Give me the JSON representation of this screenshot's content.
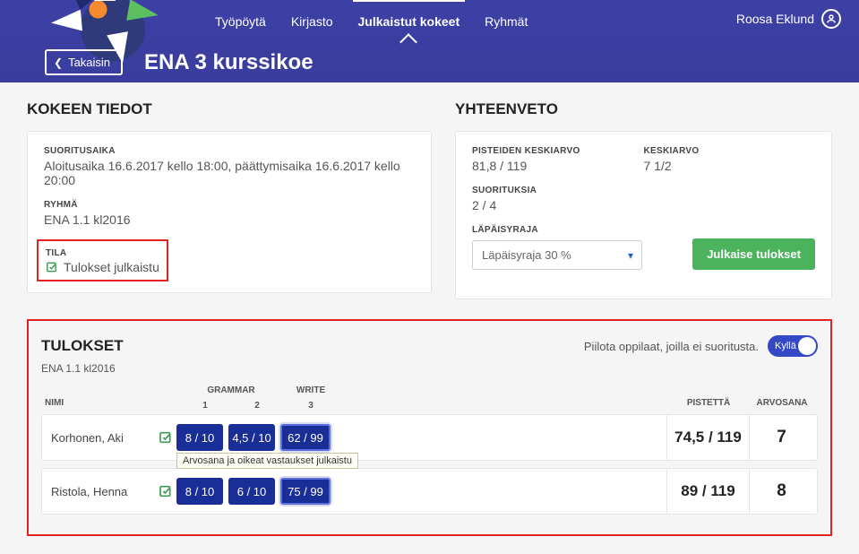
{
  "header": {
    "nav": {
      "tyopoyto": "Työpöytä",
      "kirjasto": "Kirjasto",
      "julkaistut": "Julkaistut kokeet",
      "ryhmat": "Ryhmät"
    },
    "user_name": "Roosa Eklund",
    "back_label": "Takaisin",
    "page_title": "ENA 3 kurssikoe"
  },
  "kokeen_tiedot": {
    "section_title": "KOKEEN TIEDOT",
    "suori_label": "SUORITUSAIKA",
    "suori_value": "Aloitusaika 16.6.2017 kello 18:00, päättymisaika 16.6.2017 kello 20:00",
    "ryhma_label": "RYHMÄ",
    "ryhma_value": "ENA 1.1 kl2016",
    "tila_label": "TILA",
    "tila_value": "Tulokset julkaistu"
  },
  "yhteenveto": {
    "section_title": "YHTEENVETO",
    "pka_label": "PISTEIDEN KESKIARVO",
    "pka_value": "81,8 / 119",
    "ka_label": "KESKIARVO",
    "ka_value": "7 1/2",
    "suor_label": "SUORITUKSIA",
    "suor_value": "2 / 4",
    "raja_label": "LÄPÄISYRAJA",
    "raja_value": "Läpäisyraja 30 %",
    "publish_btn": "Julkaise tulokset"
  },
  "tulokset": {
    "section_title": "TULOKSET",
    "hide_label": "Piilota oppilaat, joilla ei suoritusta.",
    "toggle_value": "Kyllä",
    "group_name": "ENA 1.1 kl2016",
    "cols": {
      "nimi": "NIMI",
      "grammar": "GRAMMAR",
      "write": "WRITE",
      "n1": "1",
      "n2": "2",
      "n3": "3",
      "pts": "PISTETTÄ",
      "grade": "ARVOSANA"
    },
    "rows": [
      {
        "name": "Korhonen, Aki",
        "g1": "8 / 10",
        "g2": "4,5 / 10",
        "w": "62 / 99",
        "pts": "74,5 / 119",
        "grade": "7"
      },
      {
        "name": "Ristola, Henna",
        "g1": "8 / 10",
        "g2": "6 / 10",
        "w": "75 / 99",
        "pts": "89 / 119",
        "grade": "8"
      }
    ],
    "tooltip": "Arvosana ja oikeat vastaukset julkaistu"
  }
}
